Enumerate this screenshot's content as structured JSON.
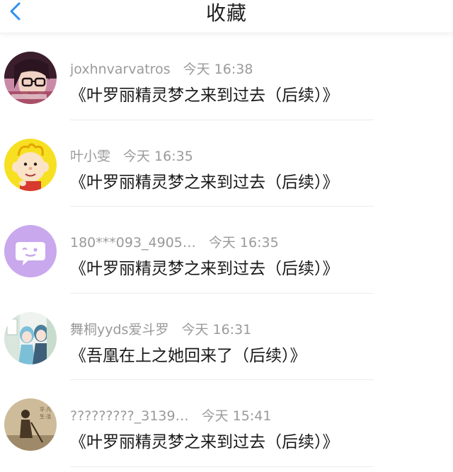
{
  "header": {
    "title": "收藏"
  },
  "favorites": [
    {
      "username": "joxhnvarvatros",
      "time": "今天 16:38",
      "title": "《叶罗丽精灵梦之来到过去（后续）》"
    },
    {
      "username": "叶小雯",
      "time": "今天 16:35",
      "title": "《叶罗丽精灵梦之来到过去（后续）》"
    },
    {
      "username": "180***093_4905…",
      "time": "今天 16:35",
      "title": "《叶罗丽精灵梦之来到过去（后续）》"
    },
    {
      "username": "舞桐yyds爱斗罗",
      "time": "今天 16:31",
      "title": "《吾凰在上之她回来了（后续）》"
    },
    {
      "username": "?????????_3139…",
      "time": "今天 15:41",
      "title": "《叶罗丽精灵梦之来到过去（后续）》"
    }
  ],
  "colors": {
    "accent": "#2f8ff0",
    "meta_text": "#9a9a9a",
    "title_text": "#1a1a1a",
    "default_avatar": "#c9a8ee"
  },
  "icons": {
    "back": "chevron-left-icon",
    "default_avatar": "chat-bubble-icon"
  }
}
